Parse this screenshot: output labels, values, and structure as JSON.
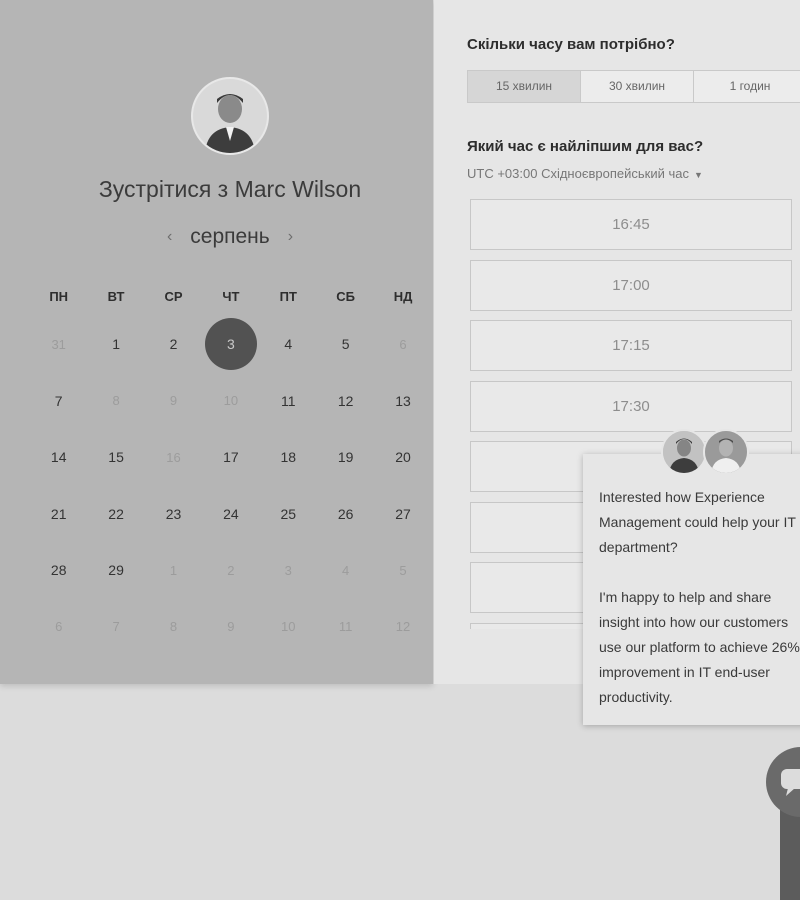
{
  "calendar": {
    "title": "Зустрітися з Marc Wilson",
    "month": "серпень",
    "prev_icon": "chevron-left-icon",
    "next_icon": "chevron-right-icon",
    "weekdays": [
      "ПН",
      "ВТ",
      "СР",
      "ЧТ",
      "ПТ",
      "СБ",
      "НД"
    ],
    "weeks": [
      [
        {
          "d": "31",
          "m": true
        },
        {
          "d": "1"
        },
        {
          "d": "2"
        },
        {
          "d": "3",
          "sel": true
        },
        {
          "d": "4"
        },
        {
          "d": "5"
        },
        {
          "d": "6",
          "m": true
        }
      ],
      [
        {
          "d": "7"
        },
        {
          "d": "8",
          "m": true
        },
        {
          "d": "9",
          "m": true
        },
        {
          "d": "10",
          "m": true
        },
        {
          "d": "11"
        },
        {
          "d": "12"
        },
        {
          "d": "13"
        }
      ],
      [
        {
          "d": "14"
        },
        {
          "d": "15"
        },
        {
          "d": "16",
          "m": true
        },
        {
          "d": "17"
        },
        {
          "d": "18"
        },
        {
          "d": "19"
        },
        {
          "d": "20"
        }
      ],
      [
        {
          "d": "21"
        },
        {
          "d": "22"
        },
        {
          "d": "23"
        },
        {
          "d": "24"
        },
        {
          "d": "25"
        },
        {
          "d": "26"
        },
        {
          "d": "27"
        }
      ],
      [
        {
          "d": "28"
        },
        {
          "d": "29"
        },
        {
          "d": "1",
          "m": true
        },
        {
          "d": "2",
          "m": true
        },
        {
          "d": "3",
          "m": true
        },
        {
          "d": "4",
          "m": true
        },
        {
          "d": "5",
          "m": true
        }
      ],
      [
        {
          "d": "6",
          "m": true
        },
        {
          "d": "7",
          "m": true
        },
        {
          "d": "8",
          "m": true
        },
        {
          "d": "9",
          "m": true
        },
        {
          "d": "10",
          "m": true
        },
        {
          "d": "11",
          "m": true
        },
        {
          "d": "12",
          "m": true
        }
      ]
    ]
  },
  "booking": {
    "duration_question": "Скільки часу вам потрібно?",
    "durations": [
      "15 хвилин",
      "30 хвилин",
      "1 годин"
    ],
    "active_duration": 0,
    "time_question": "Який час є найліпшим для вас?",
    "timezone": "UTC +03:00 Східноєвропейський час",
    "slots": [
      "16:45",
      "17:00",
      "17:15",
      "17:30",
      "",
      "",
      "",
      ""
    ]
  },
  "chat": {
    "message_1": "Interested how Experience Management could help your IT department?",
    "message_2": "I'm happy to help and share insight into how our customers use our platform to achieve 26% improvement in IT end-user productivity."
  },
  "colors": {
    "selected_day": "#525252",
    "left_panel": "#b5b5b5",
    "right_panel": "#e6e6e6"
  }
}
